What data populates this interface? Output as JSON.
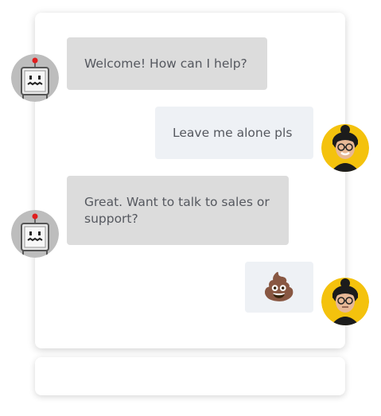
{
  "messages": [
    {
      "sender": "bot",
      "avatar": "robot-icon",
      "text": "Welcome! How can I help?"
    },
    {
      "sender": "user",
      "avatar": "user-photo",
      "text": "Leave me alone pls"
    },
    {
      "sender": "bot",
      "avatar": "robot-icon",
      "text": "Great. Want to talk to sales or support?"
    },
    {
      "sender": "user",
      "avatar": "user-photo",
      "text": "💩",
      "icon": "poop-emoji-icon"
    }
  ],
  "colors": {
    "bot_bubble": "#dcdcdc",
    "user_bubble": "#eef1f5",
    "text": "#55585f",
    "user_avatar_bg": "#f4c20d"
  }
}
